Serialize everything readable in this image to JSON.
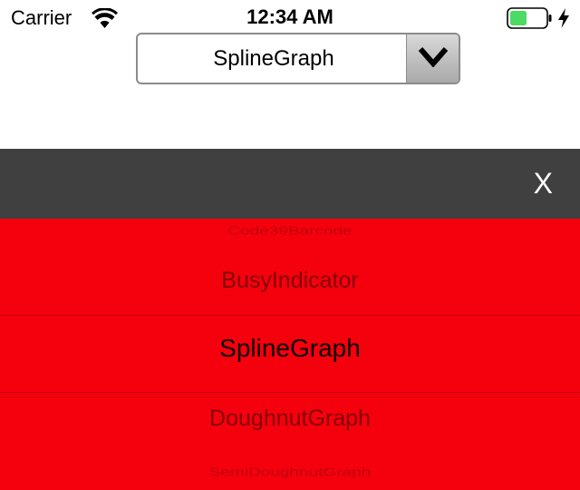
{
  "status_bar": {
    "carrier": "Carrier",
    "time": "12:34 AM",
    "battery_color": "#4cd964"
  },
  "dropdown": {
    "selected_value": "SplineGraph"
  },
  "picker": {
    "header_color": "#404040",
    "list_color": "#f5000d",
    "close_label": "X",
    "items": [
      {
        "label": "Code39Barcode"
      },
      {
        "label": "BusyIndicator"
      },
      {
        "label": "SplineGraph"
      },
      {
        "label": "DoughnutGraph"
      },
      {
        "label": "SemiDoughnutGraph"
      }
    ]
  }
}
